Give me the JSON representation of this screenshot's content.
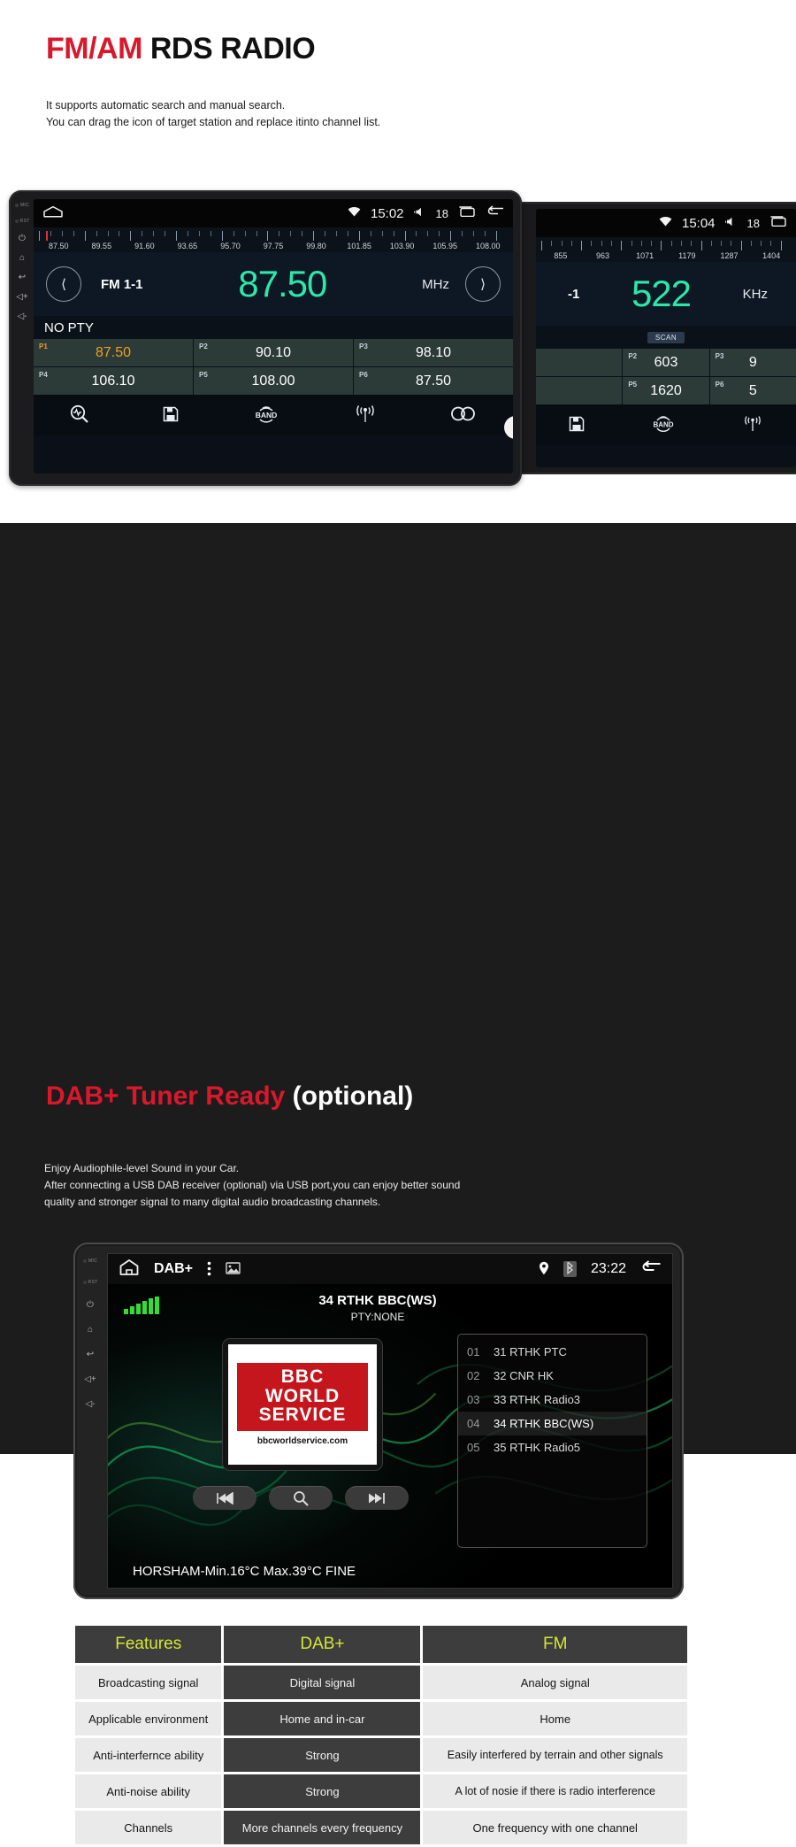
{
  "section1": {
    "title_red": "FM/AM",
    "title_black": " RDS RADIO",
    "desc_line1": "It supports automatic search and manual search.",
    "desc_line2": "You can drag the icon of target station and replace itinto channel list.",
    "side_buttons": {
      "mic": "MIC",
      "rst": "RST"
    },
    "fm_screen": {
      "status": {
        "time": "15:02",
        "volume": "18",
        "wifi_icon": "wifi-icon",
        "volume_icon": "volume-icon",
        "recents_icon": "recents-icon",
        "back_icon": "back-icon",
        "home_icon": "home-icon"
      },
      "scale_labels": [
        "87.50",
        "89.55",
        "91.60",
        "93.65",
        "95.70",
        "97.75",
        "99.80",
        "101.85",
        "103.90",
        "105.95",
        "108.00"
      ],
      "prev_icon": "prev-station-icon",
      "next_icon": "next-station-icon",
      "band_label": "FM 1-1",
      "frequency": "87.50",
      "unit": "MHz",
      "pty": "NO PTY",
      "presets": [
        {
          "slot": "P1",
          "value": "87.50",
          "active": true
        },
        {
          "slot": "P2",
          "value": "90.10",
          "active": false
        },
        {
          "slot": "P3",
          "value": "98.10",
          "active": false
        },
        {
          "slot": "P4",
          "value": "106.10",
          "active": false
        },
        {
          "slot": "P5",
          "value": "108.00",
          "active": false
        },
        {
          "slot": "P6",
          "value": "87.50",
          "active": false
        }
      ],
      "toolbar": [
        "scan-search-icon",
        "save-icon",
        "band-icon",
        "antenna-icon",
        "stereo-icon"
      ]
    },
    "am_screen": {
      "status": {
        "time": "15:04",
        "volume": "18"
      },
      "scale_labels": [
        "855",
        "963",
        "1071",
        "1179",
        "1287",
        "1404"
      ],
      "band_label": "-1",
      "frequency": "522",
      "unit": "KHz",
      "scan_chip": "SCAN",
      "presets": [
        {
          "slot": "P2",
          "value": "603"
        },
        {
          "slot": "P3",
          "value": "9"
        },
        {
          "slot": "P5",
          "value": "1620"
        },
        {
          "slot": "P6",
          "value": "5"
        }
      ],
      "toolbar": [
        "save-icon",
        "band-icon",
        "antenna-icon"
      ]
    }
  },
  "section2": {
    "title_red": "DAB+ Tuner Ready ",
    "title_white": "(optional)",
    "desc_line1": "Enjoy Audiophile-level Sound in your Car.",
    "desc_line2": "After connecting a USB DAB receiver (optional) via USB port,you can enjoy better sound",
    "desc_line3": "quality and stronger signal to many digital audio broadcasting channels.",
    "dab_screen": {
      "status": {
        "home_icon": "home-icon",
        "app_name": "DAB+",
        "menu_icon": "kebab-menu-icon",
        "image_icon": "image-icon",
        "location_icon": "location-pin-icon",
        "bluetooth_icon": "bluetooth-icon",
        "time": "23:22",
        "back_icon": "back-icon"
      },
      "signal_icon": "signal-bars-icon",
      "now_playing": "34 RTHK BBC(WS)",
      "pty": "PTY:NONE",
      "logo": {
        "line1": "BBC",
        "line2": "WORLD",
        "line3": "SERVICE",
        "url": "bbcworldservice.com"
      },
      "controls": [
        "prev-track-icon",
        "search-icon",
        "next-track-icon"
      ],
      "weather": "HORSHAM-Min.16°C Max.39°C FINE",
      "station_list": [
        {
          "index": "01",
          "name": "31 RTHK PTC",
          "selected": false
        },
        {
          "index": "02",
          "name": "32 CNR HK",
          "selected": false
        },
        {
          "index": "03",
          "name": "33 RTHK Radio3",
          "selected": false
        },
        {
          "index": "04",
          "name": "34 RTHK BBC(WS)",
          "selected": true
        },
        {
          "index": "05",
          "name": "35 RTHK Radio5",
          "selected": false
        }
      ]
    },
    "comparison": {
      "headers": [
        "Features",
        "DAB+",
        "FM"
      ],
      "rows": [
        [
          "Broadcasting signal",
          "Digital signal",
          "Analog signal"
        ],
        [
          "Applicable environment",
          "Home and in-car",
          "Home"
        ],
        [
          "Anti-interfernce ability",
          "Strong",
          "Easily interfered by terrain and other signals"
        ],
        [
          "Anti-noise ability",
          "Strong",
          "A lot of nosie if there is radio interference"
        ],
        [
          "Channels",
          "More channels every frequency",
          "One frequency with one channel"
        ]
      ]
    }
  }
}
